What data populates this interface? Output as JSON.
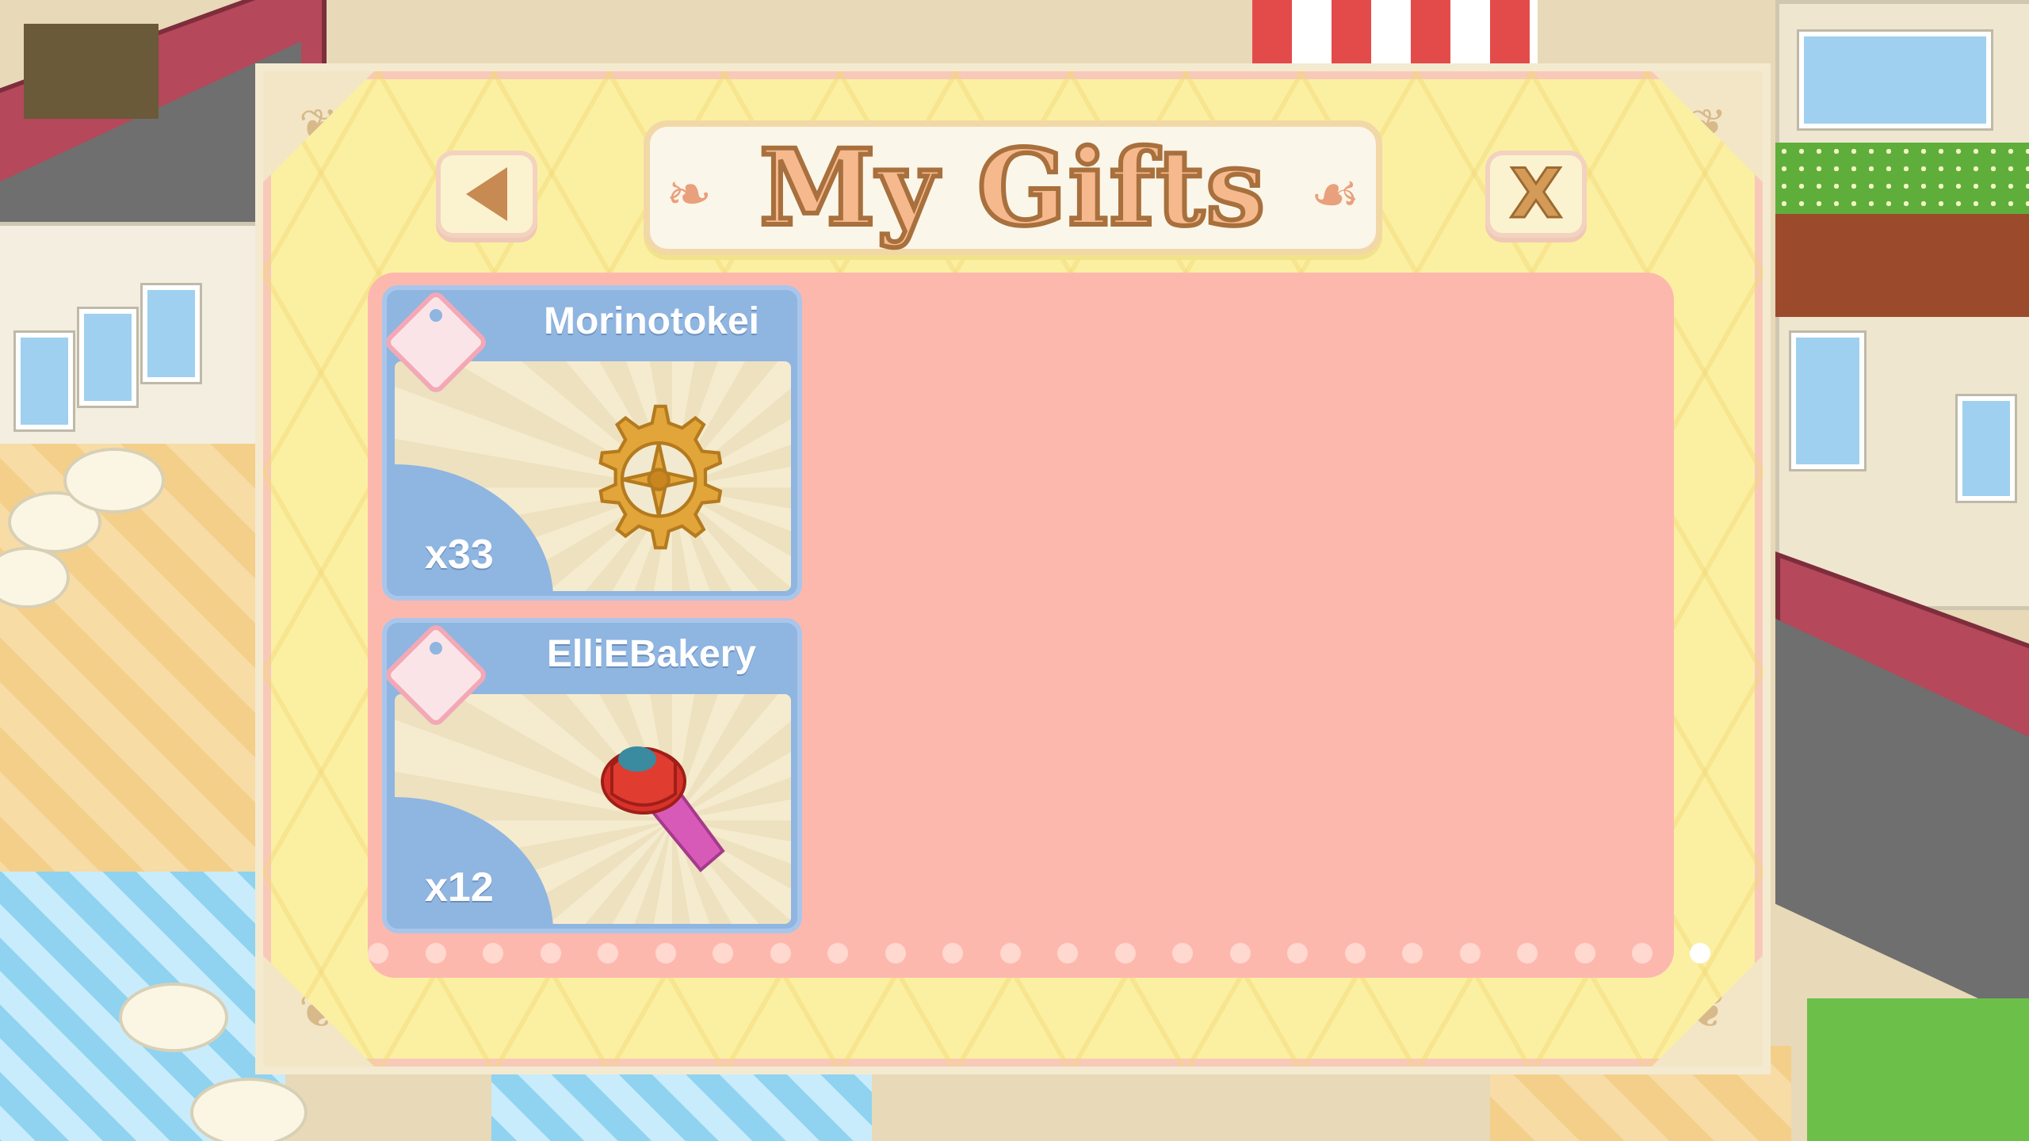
{
  "dialog": {
    "title": "My Gifts",
    "close_label": "X"
  },
  "gifts": [
    {
      "sender": "Morinotokei",
      "quantity": "x33",
      "item_icon": "gear-icon"
    },
    {
      "sender": "ElliEBakery",
      "quantity": "x12",
      "item_icon": "piping-tip-icon"
    }
  ],
  "pagination": {
    "dot_count": 24,
    "active_index": 23
  },
  "colors": {
    "dialog_bg": "#fbf0a2",
    "panel_bg": "#fdb8ae",
    "card_bg": "#8fb5e1",
    "title_fill": "#f6b98e",
    "title_stroke": "#a8703d"
  }
}
